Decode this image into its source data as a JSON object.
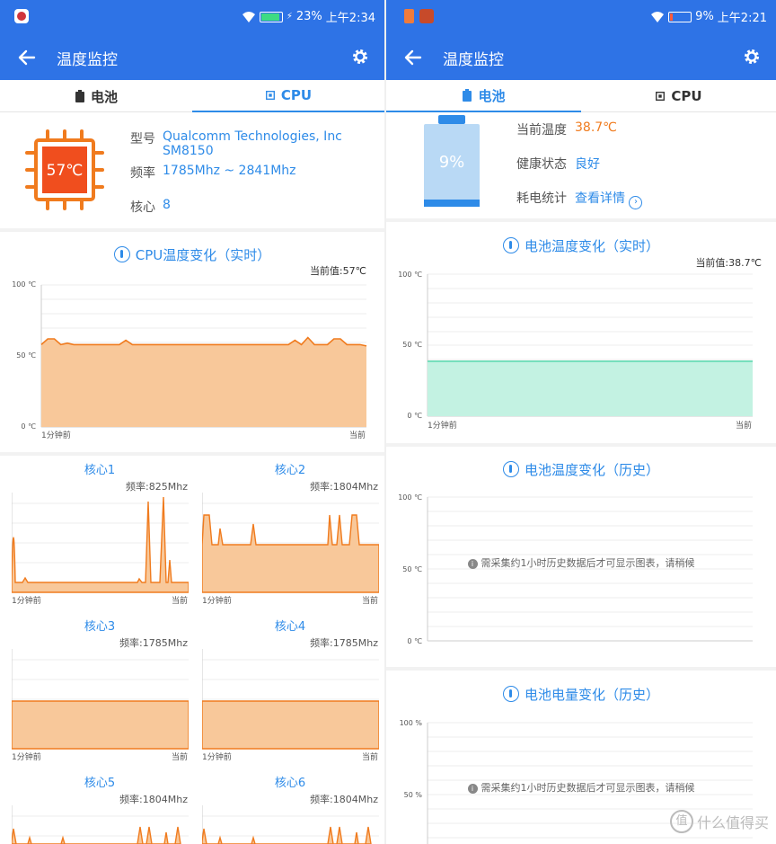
{
  "left": {
    "status": {
      "battery": "23%",
      "time": "上午2:34"
    },
    "appbar": {
      "title": "温度监控"
    },
    "tabs": [
      {
        "label": "电池",
        "active": false
      },
      {
        "label": "CPU",
        "active": true
      }
    ],
    "cpu_info": {
      "chip_temp": "57℃",
      "model_label": "型号",
      "model_value": "Qualcomm Technologies, Inc SM8150",
      "freq_label": "频率",
      "freq_value": "1785Mhz ~ 2841Mhz",
      "core_label": "核心",
      "core_value": "8"
    },
    "main_chart": {
      "title": "CPU温度变化（实时）",
      "current": "当前值:57℃",
      "y_ticks": [
        "100 ℃",
        "50 ℃",
        "0 ℃"
      ],
      "x_start": "1分钟前",
      "x_end": "当前"
    },
    "cores": [
      {
        "name": "核心1",
        "freq": "频率:825Mhz"
      },
      {
        "name": "核心2",
        "freq": "频率:1804Mhz"
      },
      {
        "name": "核心3",
        "freq": "频率:1785Mhz"
      },
      {
        "name": "核心4",
        "freq": "频率:1785Mhz"
      },
      {
        "name": "核心5",
        "freq": "频率:1804Mhz"
      },
      {
        "name": "核心6",
        "freq": "频率:1804Mhz"
      }
    ],
    "core_x_start": "1分钟前",
    "core_x_end": "当前"
  },
  "right": {
    "status": {
      "battery": "9%",
      "time": "上午2:21"
    },
    "appbar": {
      "title": "温度监控"
    },
    "tabs": [
      {
        "label": "电池",
        "active": true
      },
      {
        "label": "CPU",
        "active": false
      }
    ],
    "battery_info": {
      "percent": "9%",
      "temp_label": "当前温度",
      "temp_value": "38.7℃",
      "health_label": "健康状态",
      "health_value": "良好",
      "usage_label": "耗电统计",
      "usage_value": "查看详情"
    },
    "realtime_chart": {
      "title": "电池温度变化（实时）",
      "current": "当前值:38.7℃",
      "y_ticks": [
        "100 ℃",
        "50 ℃",
        "0 ℃"
      ],
      "x_start": "1分钟前",
      "x_end": "当前"
    },
    "history_temp": {
      "title": "电池温度变化（历史）",
      "y_ticks": [
        "100 ℃",
        "50 ℃",
        "0 ℃"
      ],
      "message": "需采集约1小时历史数据后才可显示图表，请稍候"
    },
    "history_level": {
      "title": "电池电量变化（历史）",
      "y_ticks": [
        "100 %",
        "50 %"
      ],
      "message": "需采集约1小时历史数据后才可显示图表，请稍候"
    },
    "watermark": "什么值得买"
  },
  "colors": {
    "primary": "#2e73e6",
    "accent": "#2e8be8",
    "orange": "#f07b1e",
    "orange_fill": "#f8c89a",
    "green_fill": "#c3f2e2",
    "green_line": "#5fd9b1"
  },
  "chart_data": [
    {
      "type": "area",
      "title": "CPU温度变化（实时）",
      "ylim": [
        0,
        100
      ],
      "xlabel_range": [
        "1分钟前",
        "当前"
      ],
      "values": [
        58,
        62,
        62,
        58,
        59,
        58,
        58,
        58,
        58,
        58,
        58,
        58,
        58,
        61,
        58,
        58,
        58,
        58,
        58,
        58,
        58,
        58,
        58,
        58,
        58,
        58,
        58,
        58,
        58,
        58,
        58,
        58,
        58,
        58,
        58,
        58,
        58,
        58,
        58,
        61,
        58,
        63,
        58,
        58,
        58,
        62,
        62,
        58,
        58,
        58,
        57
      ]
    },
    {
      "type": "area",
      "title": "电池温度变化（实时）",
      "ylim": [
        0,
        100
      ],
      "values": [
        38.7,
        38.7,
        38.7,
        38.7,
        38.7
      ]
    }
  ]
}
